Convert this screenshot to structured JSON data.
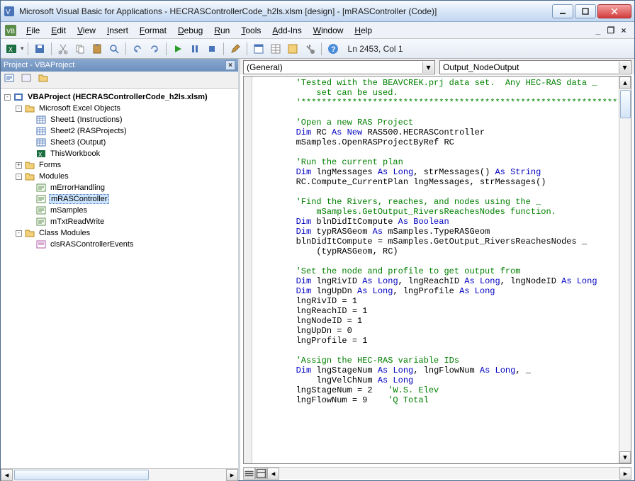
{
  "window": {
    "title": "Microsoft Visual Basic for Applications - HECRASControllerCode_h2ls.xlsm [design] - [mRASController (Code)]"
  },
  "menus": [
    "File",
    "Edit",
    "View",
    "Insert",
    "Format",
    "Debug",
    "Run",
    "Tools",
    "Add-Ins",
    "Window",
    "Help"
  ],
  "cursor_pos": "Ln 2453, Col 1",
  "project_panel": {
    "title": "Project - VBAProject",
    "root": "VBAProject (HECRASControllerCode_h2ls.xlsm)",
    "excel_objects": {
      "label": "Microsoft Excel Objects",
      "items": [
        "Sheet1 (Instructions)",
        "Sheet2 (RASProjects)",
        "Sheet3 (Output)",
        "ThisWorkbook"
      ]
    },
    "forms": {
      "label": "Forms"
    },
    "modules": {
      "label": "Modules",
      "items": [
        "mErrorHandling",
        "mRASController",
        "mSamples",
        "mTxtReadWrite"
      ],
      "selected": "mRASController"
    },
    "class_modules": {
      "label": "Class Modules",
      "items": [
        "clsRASControllerEvents"
      ]
    }
  },
  "dropdowns": {
    "object": "(General)",
    "procedure": "Output_NodeOutput"
  },
  "code_lines": [
    {
      "c": "'Tested with the BEAVCREK.prj data set.  Any HEC-RAS data _"
    },
    {
      "c": "    set can be used."
    },
    {
      "c": "'*********************************************************************"
    },
    {
      "b": ""
    },
    {
      "c": "'Open a new RAS Project"
    },
    {
      "seg": [
        [
          "k",
          "Dim"
        ],
        [
          "n",
          " RC "
        ],
        [
          "k",
          "As New"
        ],
        [
          "n",
          " RAS500.HECRASController"
        ]
      ]
    },
    {
      "n": "mSamples.OpenRASProjectByRef RC"
    },
    {
      "b": ""
    },
    {
      "c": "'Run the current plan"
    },
    {
      "seg": [
        [
          "k",
          "Dim"
        ],
        [
          "n",
          " lngMessages "
        ],
        [
          "k",
          "As Long"
        ],
        [
          "n",
          ", strMessages() "
        ],
        [
          "k",
          "As String"
        ]
      ]
    },
    {
      "n": "RC.Compute_CurrentPlan lngMessages, strMessages()"
    },
    {
      "b": ""
    },
    {
      "c": "'Find the Rivers, reaches, and nodes using the _"
    },
    {
      "c": "    mSamples.GetOutput_RiversReachesNodes function."
    },
    {
      "seg": [
        [
          "k",
          "Dim"
        ],
        [
          "n",
          " blnDidItCompute "
        ],
        [
          "k",
          "As Boolean"
        ]
      ]
    },
    {
      "seg": [
        [
          "k",
          "Dim"
        ],
        [
          "n",
          " typRASGeom "
        ],
        [
          "k",
          "As"
        ],
        [
          "n",
          " mSamples.TypeRASGeom"
        ]
      ]
    },
    {
      "n": "blnDidItCompute = mSamples.GetOutput_RiversReachesNodes _"
    },
    {
      "n": "    (typRASGeom, RC)"
    },
    {
      "b": ""
    },
    {
      "c": "'Set the node and profile to get output from"
    },
    {
      "seg": [
        [
          "k",
          "Dim"
        ],
        [
          "n",
          " lngRivID "
        ],
        [
          "k",
          "As Long"
        ],
        [
          "n",
          ", lngReachID "
        ],
        [
          "k",
          "As Long"
        ],
        [
          "n",
          ", lngNodeID "
        ],
        [
          "k",
          "As Long"
        ]
      ]
    },
    {
      "seg": [
        [
          "k",
          "Dim"
        ],
        [
          "n",
          " lngUpDn "
        ],
        [
          "k",
          "As Long"
        ],
        [
          "n",
          ", lngProfile "
        ],
        [
          "k",
          "As Long"
        ]
      ]
    },
    {
      "n": "lngRivID = 1"
    },
    {
      "n": "lngReachID = 1"
    },
    {
      "n": "lngNodeID = 1"
    },
    {
      "n": "lngUpDn = 0"
    },
    {
      "n": "lngProfile = 1"
    },
    {
      "b": ""
    },
    {
      "c": "'Assign the HEC-RAS variable IDs"
    },
    {
      "seg": [
        [
          "k",
          "Dim"
        ],
        [
          "n",
          " lngStageNum "
        ],
        [
          "k",
          "As Long"
        ],
        [
          "n",
          ", lngFlowNum "
        ],
        [
          "k",
          "As Long"
        ],
        [
          "n",
          ", _"
        ]
      ]
    },
    {
      "seg": [
        [
          "n",
          "    lngVelChNum "
        ],
        [
          "k",
          "As Long"
        ]
      ]
    },
    {
      "seg": [
        [
          "n",
          "lngStageNum = 2   "
        ],
        [
          "c",
          "'W.S. Elev"
        ]
      ]
    },
    {
      "seg": [
        [
          "n",
          "lngFlowNum = 9    "
        ],
        [
          "c",
          "'Q Total"
        ]
      ]
    }
  ]
}
